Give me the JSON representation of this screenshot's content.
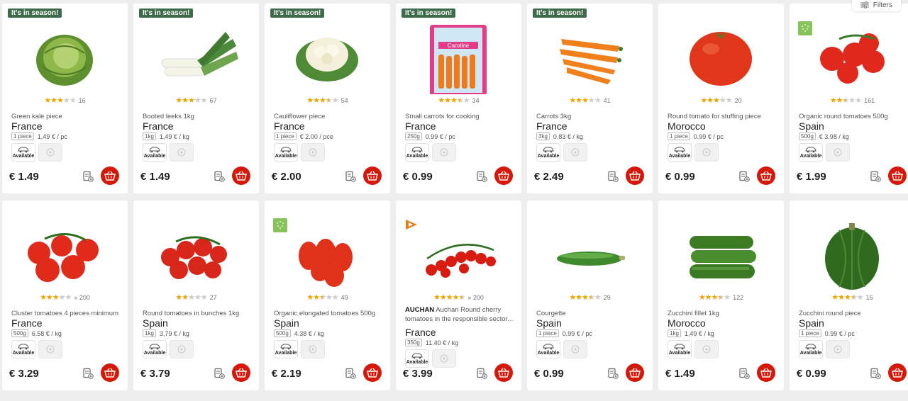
{
  "filters_label": "Filters",
  "available_label": "Available",
  "colors": {
    "season_badge": "#3e6b4a",
    "cart": "#d6180b",
    "star": "#f0a500",
    "bio": "#86c35a"
  },
  "products": [
    {
      "badge": "It's in season!",
      "stars": 3,
      "count": "16",
      "name": "Green kale piece",
      "origin": "France",
      "unit": "1 piece",
      "unit_price": "1,49 € / pc",
      "price": "€ 1.49",
      "img": "cabbage"
    },
    {
      "badge": "It's in season!",
      "stars": 3,
      "count": "67",
      "name": "Booted leeks 1kg",
      "origin": "France",
      "unit": "1kg",
      "unit_price": "1,49 € / kg",
      "price": "€ 1.49",
      "img": "leek"
    },
    {
      "badge": "It's in season!",
      "stars": 3.5,
      "count": "54",
      "name": "Cauliflower piece",
      "origin": "France",
      "unit": "1 piece",
      "unit_price": "€ 2.00 / pce",
      "price": "€ 2.00",
      "img": "cauliflower"
    },
    {
      "badge": "It's in season!",
      "stars": 3.5,
      "count": "34",
      "name": "Small carrots for cooking",
      "origin": "France",
      "unit": "250g",
      "unit_price": "0.99 € / pc",
      "price": "€ 0.99",
      "img": "carrotbag"
    },
    {
      "badge": "It's in season!",
      "stars": 3,
      "count": "41",
      "name": "Carrots 3kg",
      "origin": "France",
      "unit": "3kg",
      "unit_price": "0.83 € / kg",
      "price": "€ 2.49",
      "img": "carrots"
    },
    {
      "badge": "",
      "stars": 3,
      "count": "20",
      "name": "Round tomato for stuffing piece",
      "origin": "Morocco",
      "unit": "1 piece",
      "unit_price": "0.99 € / pc",
      "price": "€ 0.99",
      "img": "bigtomato"
    },
    {
      "badge": "",
      "bio": true,
      "stars": 2.5,
      "count": "161",
      "name": "Organic round tomatoes 500g",
      "origin": "Spain",
      "unit": "500g",
      "unit_price": "€ 3.98 / kg",
      "price": "€ 1.99",
      "img": "tomatoes"
    },
    {
      "badge": "",
      "stars": 3,
      "count": "» 200",
      "name": "Cluster tomatoes 4 pieces minimum",
      "origin": "France",
      "unit": "500g",
      "unit_price": "6.58 € / kg",
      "price": "€ 3.29",
      "img": "cluster"
    },
    {
      "badge": "",
      "stars": 2,
      "count": "27",
      "name": "Round tomatoes in bunches 1kg",
      "origin": "Spain",
      "unit": "1kg",
      "unit_price": "3,79 € / kg",
      "price": "€ 3.79",
      "img": "bunch"
    },
    {
      "badge": "",
      "bio": true,
      "stars": 2.5,
      "count": "49",
      "name": "Organic elongated tomatoes 500g",
      "origin": "Spain",
      "unit": "500g",
      "unit_price": "4.38 € / kg",
      "price": "€ 2.19",
      "img": "elongated"
    },
    {
      "badge": "",
      "auchan": true,
      "stars": 4.5,
      "count": "» 200",
      "brand": "AUCHAN",
      "name": "Auchan Round cherry tomatoes in the responsible sector...",
      "origin": "France",
      "unit": "350g",
      "unit_price": "11.40 € / kg",
      "price": "€ 3.99",
      "img": "cherry"
    },
    {
      "badge": "",
      "stars": 3.5,
      "count": "29",
      "name": "Courgette",
      "origin": "Spain",
      "unit": "1 piece",
      "unit_price": "0.99 € / pc",
      "price": "€ 0.99",
      "img": "courgette"
    },
    {
      "badge": "",
      "stars": 3.5,
      "count": "122",
      "name": "Zucchini fillet 1kg",
      "origin": "Morocco",
      "unit": "1kg",
      "unit_price": "1,49 € / kg",
      "price": "€ 1.49",
      "img": "zucchinis"
    },
    {
      "badge": "",
      "stars": 3.5,
      "count": "16",
      "name": "Zucchini round piece",
      "origin": "Spain",
      "unit": "1 piece",
      "unit_price": "0.99 € / pc",
      "price": "€ 0.99",
      "img": "roundzucchini"
    }
  ]
}
